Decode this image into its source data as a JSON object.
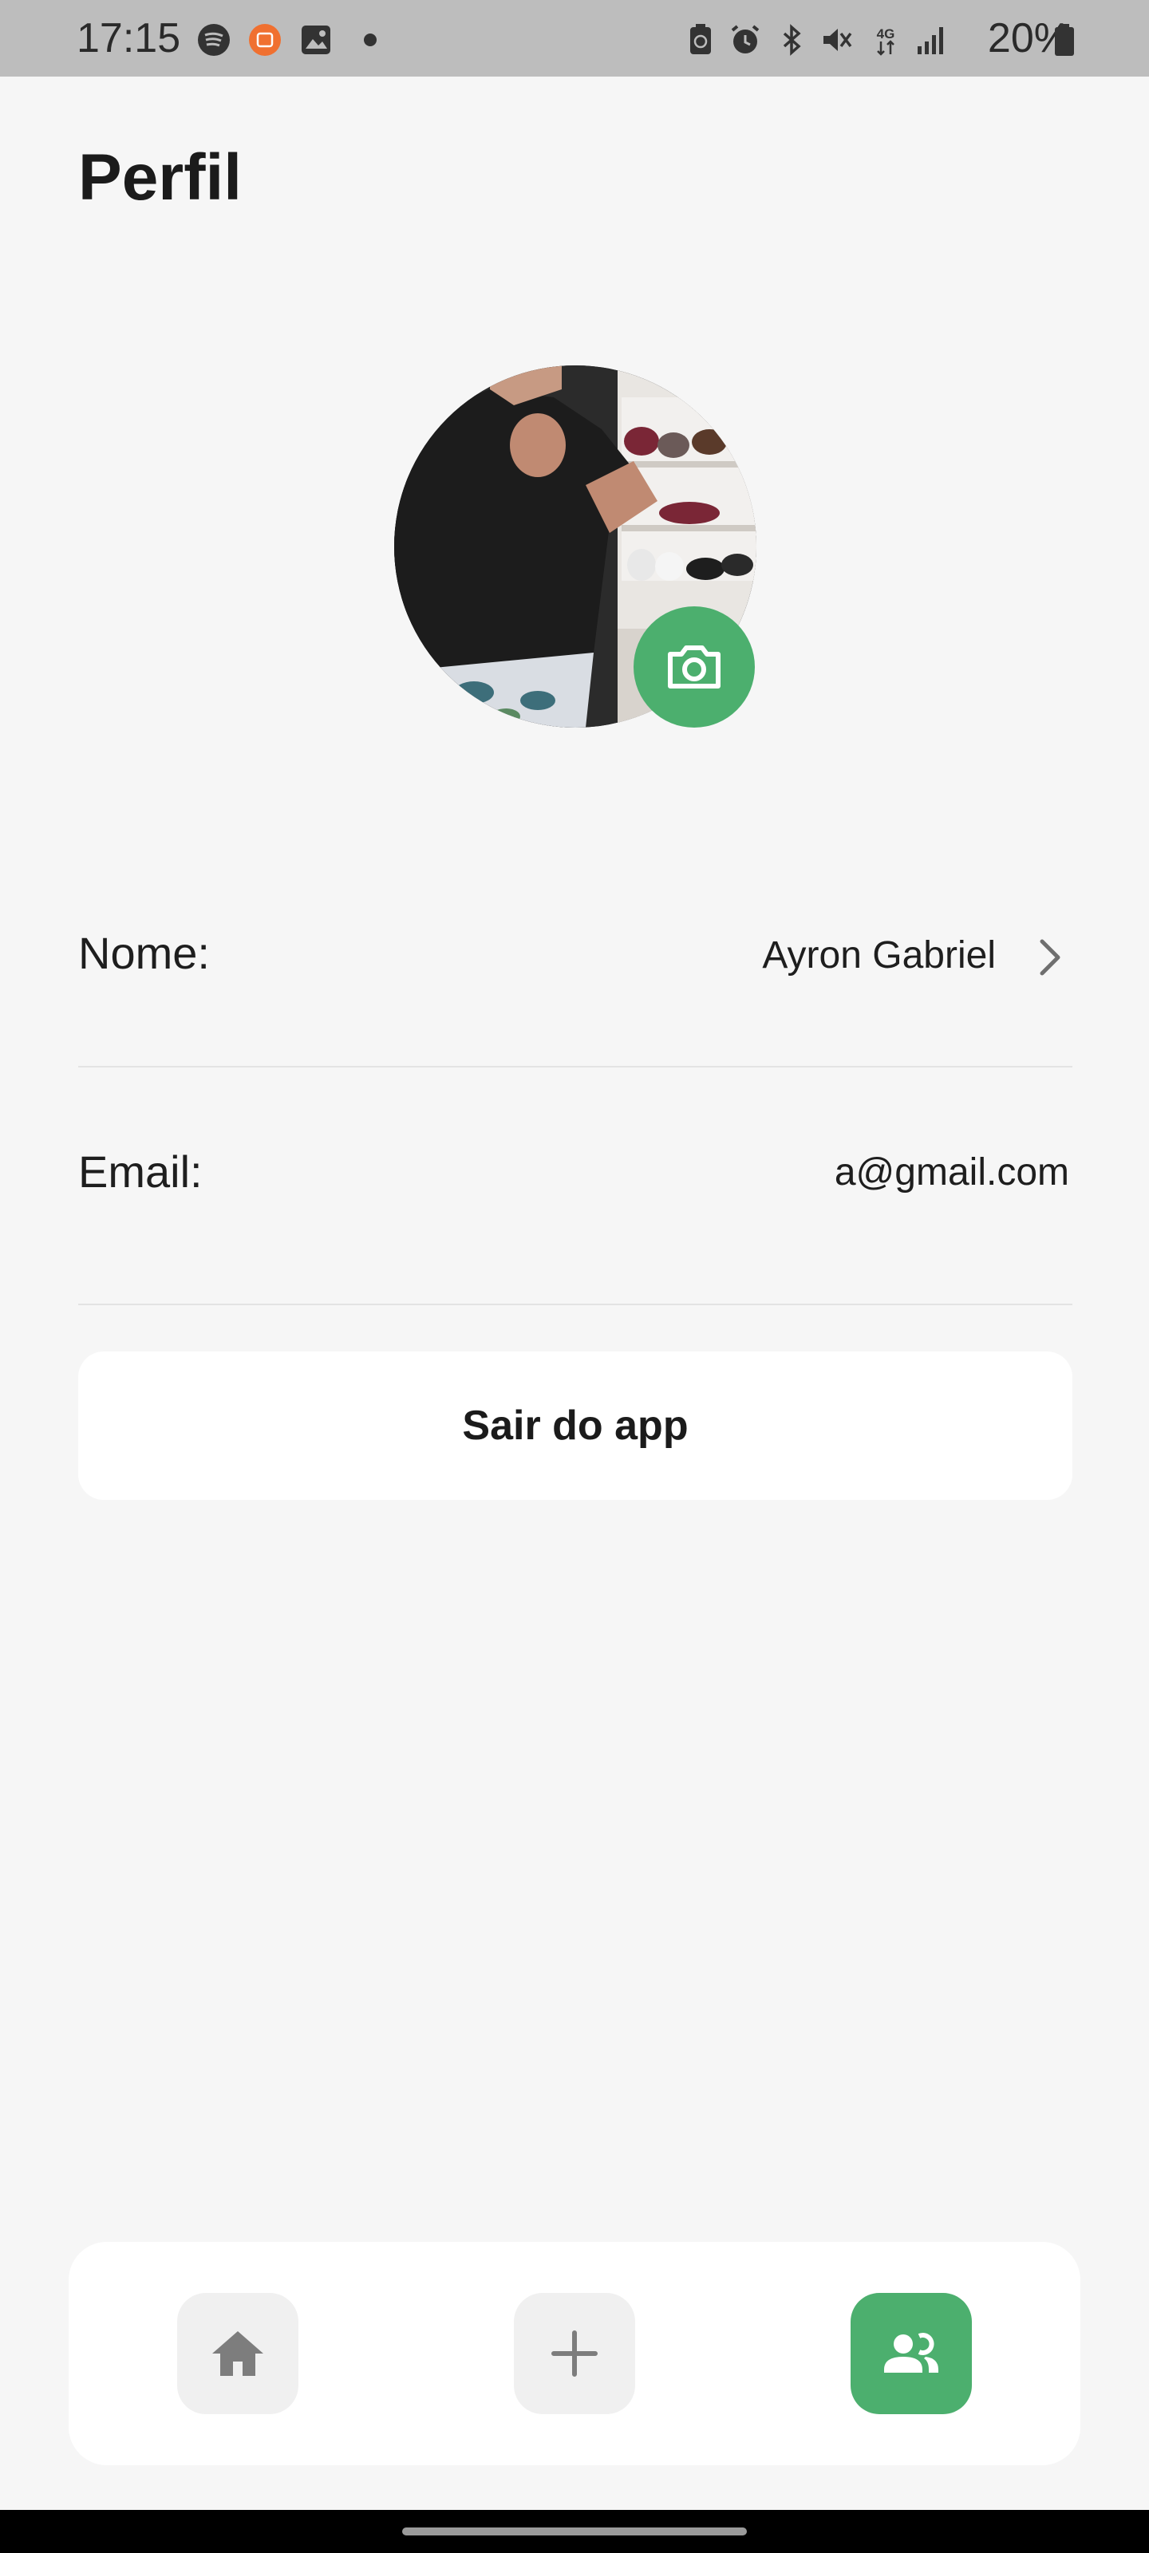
{
  "status_bar": {
    "time": "17:15",
    "battery_percent": "20%",
    "left_icons": [
      "spotify-icon",
      "mi-app-icon",
      "gallery-icon",
      "dot-icon"
    ],
    "right_icons": [
      "battery-saver-icon",
      "alarm-icon",
      "bluetooth-icon",
      "vibrate-icon",
      "4g-icon",
      "signal-icon",
      "battery-icon"
    ],
    "network_label": "4G"
  },
  "page": {
    "title": "Perfil"
  },
  "profile": {
    "avatar_icon": "user-photo",
    "camera_icon": "camera-icon"
  },
  "fields": {
    "name_label": "Nome:",
    "name_value": "Ayron Gabriel",
    "email_label": "Email:",
    "email_value": "a@gmail.com"
  },
  "actions": {
    "logout_label": "Sair do app"
  },
  "bottom_nav": {
    "items": [
      {
        "icon": "home-icon",
        "active": false
      },
      {
        "icon": "plus-icon",
        "active": false
      },
      {
        "icon": "profile-icon",
        "active": true
      }
    ]
  },
  "colors": {
    "accent": "#4caf6e",
    "background": "#f6f6f6",
    "card": "#ffffff",
    "status_bar": "#bdbdbd"
  }
}
